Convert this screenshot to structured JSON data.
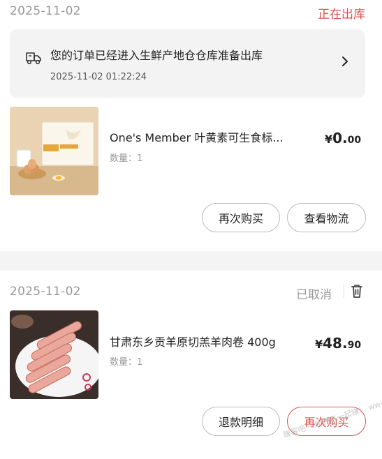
{
  "colors": {
    "accent_red": "#d9534f",
    "muted": "#999999"
  },
  "order1": {
    "date": "2025-11-02",
    "status": "正在出库",
    "logistics": {
      "icon": "truck-icon",
      "message": "您的订单已经进入生鲜产地仓仓库准备出库",
      "time": "2025-11-02 01:22:24"
    },
    "product": {
      "name": "One's Member 叶黄素可生食标...",
      "quantity": "数量：1",
      "price_symbol": "¥",
      "price_int": "0.",
      "price_dec": "00"
    },
    "buttons": {
      "rebuy": "再次购买",
      "track": "查看物流"
    }
  },
  "order2": {
    "date": "2025-11-02",
    "status": "已取消",
    "product": {
      "name": "甘肃东乡贡羊原切羔羊肉卷 400g",
      "quantity": "数量：1",
      "price_symbol": "¥",
      "price_int": "48.",
      "price_dec": "90"
    },
    "buttons": {
      "refund": "退款明细",
      "rebuy": "再次购买"
    }
  },
  "watermark": "赚客吧 一起拥有一起赚！ www.zuanke8.com"
}
